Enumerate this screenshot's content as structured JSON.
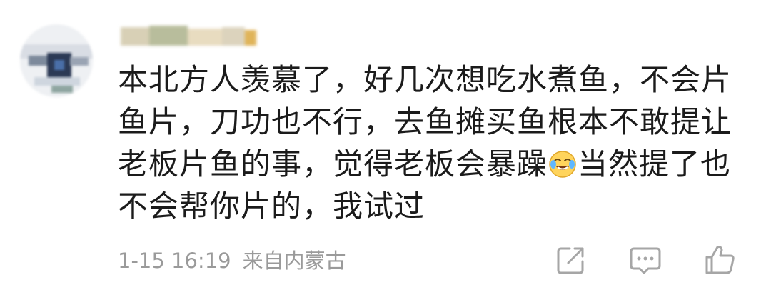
{
  "comment": {
    "username": "",
    "text_before_emoji": "本北方人羡慕了，好几次想吃水煮鱼，不会片鱼片，刀功也不行，去鱼摊买鱼根本不敢提让老板片鱼的事，觉得老板会暴躁",
    "emoji": "laughing-crying-emoji",
    "text_after_emoji": "当然提了也不会帮你片的，我试过",
    "time": "1-15 16:19",
    "location": "来自内蒙古"
  },
  "actions": {
    "share_icon": "share-icon",
    "reply_icon": "comment-icon",
    "like_icon": "thumbs-up-icon"
  },
  "colors": {
    "text": "#1b1b1b",
    "meta": "#9a9a9a",
    "icon": "#a6a6a6",
    "background": "#ffffff"
  }
}
